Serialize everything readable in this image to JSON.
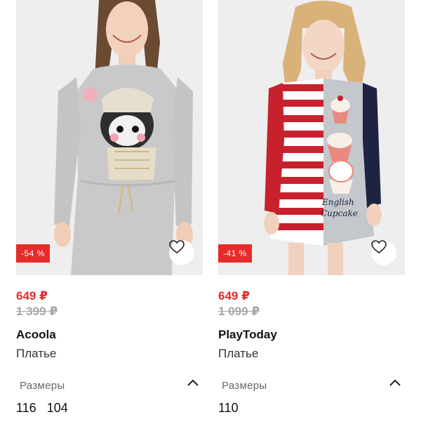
{
  "products": [
    {
      "discount": "-54 %",
      "price_new": "649 ₽",
      "price_old": "1 399 ₽",
      "brand": "Acoola",
      "type": "Платье",
      "sizes_label": "Размеры",
      "sizes": [
        "116",
        "104"
      ],
      "dress_color": "#c9c9c9",
      "print": "raccoon"
    },
    {
      "discount": "-41 %",
      "price_new": "649 ₽",
      "price_old": "1 099 ₽",
      "brand": "PlayToday",
      "type": "Платье",
      "sizes_label": "Размеры",
      "sizes": [
        "110"
      ],
      "print_text_1": "English",
      "print_text_2": "Cupcake",
      "colors": {
        "red": "#c8212e",
        "navy": "#1d2340",
        "grey": "#c4c7cc"
      }
    }
  ],
  "colors": {
    "discount": "#e52b2b",
    "old_price": "#a5a5a5"
  }
}
